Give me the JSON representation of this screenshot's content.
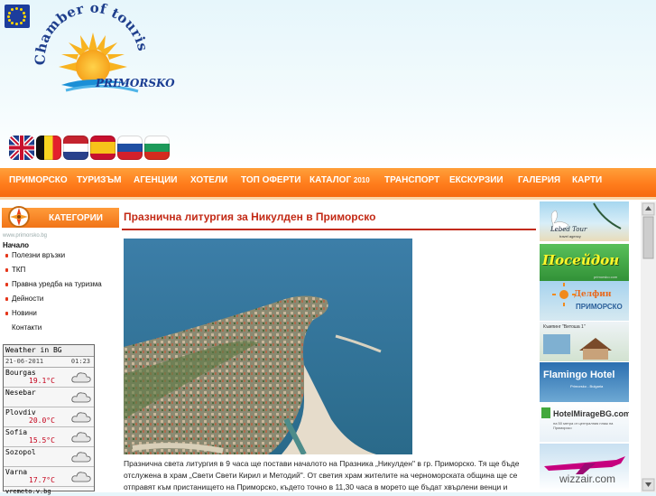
{
  "logo": {
    "arc_text": "Chamber of tourism",
    "name": "PRIMORSKO"
  },
  "languages": [
    "english-flag",
    "belgian-flag",
    "dutch-flag",
    "spanish-flag",
    "slovenian-flag",
    "bulgarian-flag"
  ],
  "nav": {
    "items": [
      {
        "label": "ПРИМОРСКО",
        "sub": ""
      },
      {
        "label": "ТУРИЗЪМ",
        "sub": ""
      },
      {
        "label": "АГЕНЦИИ",
        "sub": ""
      },
      {
        "label": "ХОТЕЛИ",
        "sub": ""
      },
      {
        "label": "ТОП ОФЕРТИ",
        "sub": ""
      },
      {
        "label": "КАТАЛОГ",
        "sub": "2010"
      },
      {
        "label": "ТРАНСПОРТ",
        "sub": ""
      },
      {
        "label": "ЕКСКУРЗИИ",
        "sub": ""
      },
      {
        "label": "ГАЛЕРИЯ",
        "sub": ""
      },
      {
        "label": "КАРТИ",
        "sub": ""
      }
    ]
  },
  "sidebar": {
    "header": "КАТЕГОРИИ",
    "sub": "www.primorsko.bg",
    "home": "Начало",
    "items": [
      {
        "label": "Полезни връзки"
      },
      {
        "label": "ТКП"
      },
      {
        "label": "Правна уредба на туризма"
      },
      {
        "label": "Дейности"
      },
      {
        "label": "Новини"
      },
      {
        "label": "Контакти"
      }
    ]
  },
  "weather": {
    "title": "Weather in BG",
    "date": "21-06-2011",
    "time": "01:23",
    "cities": [
      {
        "name": "Bourgas",
        "temp": "19.1°C"
      },
      {
        "name": "Nesebar",
        "temp": ""
      },
      {
        "name": "Plovdiv",
        "temp": "20.0°C"
      },
      {
        "name": "Sofia",
        "temp": "15.5°C"
      },
      {
        "name": "Sozopol",
        "temp": ""
      },
      {
        "name": "Varna",
        "temp": "17.7°C"
      }
    ],
    "footer": "vremeto.v.bg"
  },
  "article": {
    "title": "Празнична литургия за Никулден в Приморско",
    "caption": "Празнична света литургия в 9 часа ще постави началото на Празника „Никулден\" в гр. Приморско. Тя ще бъде отслужена в храм „Свети Свети Кирил и Методий\". От светия храм жителите на черноморската община ще се отправят към пристанището на Приморско, където точно в 11,30 часа в морето ще бъдат хвърлени  венци и"
  },
  "ads": [
    {
      "name": "Lebed Tour",
      "sub": "travel agency"
    },
    {
      "name": "Посейдон",
      "sub": "primorsko.com"
    },
    {
      "name": "Делфин",
      "sub": "ПРИМОРСКО"
    },
    {
      "name": "Къмпинг \"Витоша 1\"",
      "sub": ""
    },
    {
      "name": "Flamingo Hotel",
      "sub": "Primorsko - Bulgaria"
    },
    {
      "name": "HotelMirageBG.com",
      "sub": "на 50 метра от централния плаж на Приморско"
    },
    {
      "name": "wizzair.com",
      "sub": ""
    }
  ],
  "colors": {
    "nav": "#ff7d1c",
    "title": "#c32a16",
    "temp": "#c4001a"
  }
}
